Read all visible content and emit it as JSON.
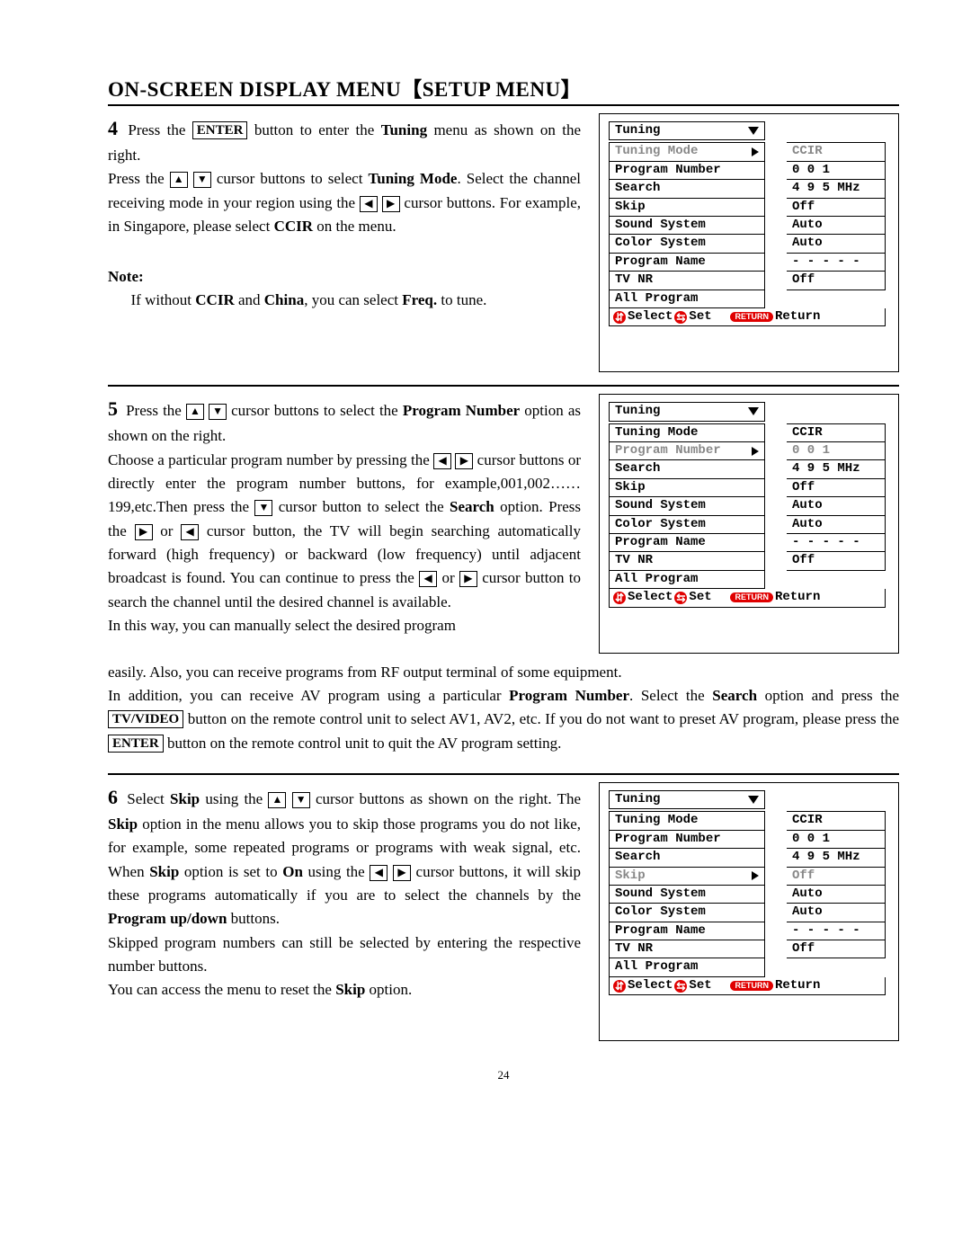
{
  "title": "ON-SCREEN DISPLAY MENU【SETUP MENU】",
  "pagenum": "24",
  "icons": {
    "up": "▲",
    "down": "▼",
    "left": "◀",
    "right": "▶",
    "select_sym": "⇔",
    "set_sym": "ⓘ"
  },
  "labels": {
    "enter": "ENTER",
    "tvvideo": "TV/VIDEO",
    "return": "RETURN",
    "select": "Select",
    "set": "Set",
    "retlabel": "Return"
  },
  "osd": {
    "title": "Tuning",
    "items": [
      {
        "label": "Tuning Mode",
        "value": "CCIR"
      },
      {
        "label": "Program Number",
        "value": "0 0 1"
      },
      {
        "label": "Search",
        "value": "4 9 5 MHz"
      },
      {
        "label": "Skip",
        "value": "Off"
      },
      {
        "label": "Sound System",
        "value": "Auto"
      },
      {
        "label": "Color System",
        "value": "Auto"
      },
      {
        "label": "Program Name",
        "value": "- - - - -"
      },
      {
        "label": "TV NR",
        "value": "Off"
      },
      {
        "label": "All Program",
        "value": ""
      }
    ]
  },
  "step4": {
    "num": "4",
    "p1a": " Press the ",
    "p1b": " button to enter the ",
    "p1c": "Tuning",
    "p1d": " menu as shown on the right.",
    "p2a": "Press the ",
    "p2b": " cursor buttons to select ",
    "p2c": "Tuning Mode",
    "p2d": ". Select the channel receiving mode in your region using the ",
    "p2e": " cursor buttons. For example, in Singapore, please select ",
    "p2f": "CCIR",
    "p2g": " on the menu.",
    "note_label": "Note:",
    "note_a": "If without ",
    "note_b": "CCIR",
    "note_c": " and ",
    "note_d": "China",
    "note_e": ", you can select ",
    "note_f": "Freq.",
    "note_g": " to tune."
  },
  "step5": {
    "num": "5",
    "p1a": " Press the ",
    "p1b": " cursor buttons to select the ",
    "p1c": "Program Number",
    "p1d": " option as shown on the right.",
    "p2a": "Choose a particular program number by pressing the ",
    "p2b": " cursor buttons or directly enter the program number buttons, for example,001,002……199,etc.Then press the ",
    "p2c": " cursor button to select the ",
    "p2d": "Search",
    "p2e": " option. Press the ",
    "p2f": " or ",
    "p2g": " cursor button, the TV will begin searching automatically forward (high frequency) or backward (low frequency) until adjacent broadcast is found. You can continue to press the ",
    "p2h": " cursor button to search the channel until the desired channel is available.",
    "p3": "In this way, you can manually select the desired program",
    "full1": "easily. Also, you can receive programs from RF output terminal of some equipment.",
    "full2a": "In addition, you can receive AV program using a particular ",
    "full2b": "Program Number",
    "full2c": ". Select the ",
    "full2d": "Search",
    "full2e": " option and press the ",
    "full2f": " button on the remote control unit to select AV1, AV2, etc. If you do not want to preset AV program, please press the ",
    "full2g": " button on the remote control unit to quit the AV program setting."
  },
  "step6": {
    "num": "6",
    "p1a": " Select ",
    "p1b": "Skip",
    "p1c": " using the ",
    "p1d": " cursor buttons as shown on the right. The ",
    "p1e": "Skip",
    "p1f": " option in the menu allows you to skip those programs you do not like, for example, some repeated programs or programs with weak signal, etc. When ",
    "p1g": "Skip",
    "p1h": " option is set to ",
    "p1i": "On",
    "p1j": " using the ",
    "p1k": " cursor buttons, it will skip these programs automatically if you are to select the channels by the ",
    "p1l": "Program up/down",
    "p1m": " buttons.",
    "p2": "Skipped program numbers can still be selected by entering the respective number buttons.",
    "p3a": "You can access the menu to reset the ",
    "p3b": "Skip",
    "p3c": " option."
  }
}
